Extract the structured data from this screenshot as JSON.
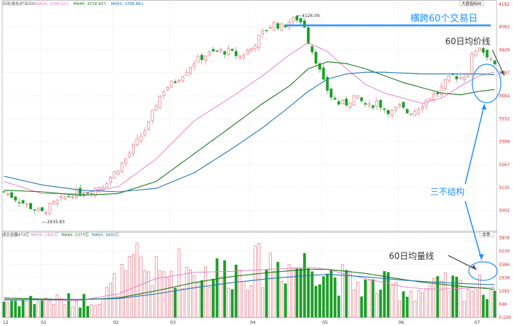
{
  "header": {
    "price_segments": [
      {
        "text": "日线(复权)",
        "color": "#555555"
      },
      {
        "text": "沪深300",
        "color": "#555555"
      },
      {
        "text": "MA20: 3794.22↑",
        "color": "#e377c2"
      },
      {
        "text": "MA40: 3716.93↑",
        "color": "#1a7a1a"
      },
      {
        "text": "MA60: 3786.88↓",
        "color": "#1f77b4"
      }
    ],
    "volume_segments": [
      {
        "text": "成交金额",
        "color": "#555555"
      },
      {
        "text": "1472亿",
        "color": "#555555"
      },
      {
        "text": "MA20: 1491亿",
        "color": "#e377c2"
      },
      {
        "text": "MA40: 1377亿",
        "color": "#1a7a1a"
      },
      {
        "text": "MA60: 1601亿",
        "color": "#1f77b4"
      }
    ],
    "top_right_button": "大盘指标纠",
    "volume_right_button": "全景"
  },
  "colors": {
    "up": "#e0606f",
    "down": "#1e9e2a",
    "ma20": "#e377c2",
    "ma40": "#1a7a1a",
    "ma60": "#1f77b4",
    "annotation": "#1e90ff",
    "grid": "#bfbfbf",
    "axis_text": "#d62728"
  },
  "chart_data": {
    "type": "candlestick",
    "price_axis": {
      "ylim": [
        2900,
        4200
      ],
      "ticks": [
        "4192",
        "4062",
        "3929",
        "3797",
        "3664",
        "3532",
        "3399",
        "3267",
        "3135",
        "3002"
      ],
      "tick_values": [
        4192,
        4062,
        3929,
        3797,
        3664,
        3532,
        3399,
        3267,
        3135,
        3002
      ]
    },
    "volume_axis": {
      "ylim": [
        0,
        3900
      ],
      "ticks": [
        "3876",
        "3230",
        "2584",
        "1938",
        "1292",
        "646",
        "0,100"
      ],
      "tick_values": [
        3876,
        3230,
        2584,
        1938,
        1292,
        646,
        0
      ]
    },
    "x_labels": [
      {
        "label": "12",
        "index": 0
      },
      {
        "label": "01",
        "index": 10
      },
      {
        "label": "02",
        "index": 29
      },
      {
        "label": "03",
        "index": 44
      },
      {
        "label": "04",
        "index": 65
      },
      {
        "label": "05",
        "index": 84
      },
      {
        "label": "06",
        "index": 104
      },
      {
        "label": "07",
        "index": 124
      }
    ],
    "num_bars": 130,
    "price_keypoints": [
      [
        0,
        3110
      ],
      [
        4,
        3060
      ],
      [
        8,
        3010
      ],
      [
        10,
        2990
      ],
      [
        13,
        3040
      ],
      [
        18,
        3100
      ],
      [
        22,
        3110
      ],
      [
        26,
        3150
      ],
      [
        29,
        3220
      ],
      [
        32,
        3300
      ],
      [
        35,
        3400
      ],
      [
        38,
        3500
      ],
      [
        40,
        3620
      ],
      [
        42,
        3700
      ],
      [
        45,
        3750
      ],
      [
        47,
        3790
      ],
      [
        50,
        3860
      ],
      [
        53,
        3900
      ],
      [
        56,
        3920
      ],
      [
        59,
        3920
      ],
      [
        62,
        3890
      ],
      [
        65,
        3940
      ],
      [
        67,
        4000
      ],
      [
        69,
        4050
      ],
      [
        71,
        4080
      ],
      [
        73,
        4060
      ],
      [
        75,
        4090
      ],
      [
        77,
        4110
      ],
      [
        79,
        4070
      ],
      [
        80,
        3980
      ],
      [
        82,
        3870
      ],
      [
        84,
        3740
      ],
      [
        86,
        3660
      ],
      [
        88,
        3620
      ],
      [
        90,
        3620
      ],
      [
        92,
        3660
      ],
      [
        94,
        3630
      ],
      [
        96,
        3600
      ],
      [
        98,
        3630
      ],
      [
        100,
        3590
      ],
      [
        102,
        3570
      ],
      [
        104,
        3600
      ],
      [
        106,
        3570
      ],
      [
        108,
        3580
      ],
      [
        110,
        3620
      ],
      [
        112,
        3660
      ],
      [
        114,
        3680
      ],
      [
        116,
        3740
      ],
      [
        118,
        3780
      ],
      [
        120,
        3770
      ],
      [
        122,
        3800
      ],
      [
        123,
        3890
      ],
      [
        124,
        3930
      ],
      [
        125,
        3950
      ],
      [
        126,
        3920
      ],
      [
        127,
        3900
      ],
      [
        128,
        3880
      ],
      [
        129,
        3830
      ]
    ],
    "volume_keypoints": [
      [
        0,
        800
      ],
      [
        10,
        850
      ],
      [
        20,
        820
      ],
      [
        26,
        1000
      ],
      [
        28,
        1400
      ],
      [
        30,
        1800
      ],
      [
        33,
        2100
      ],
      [
        35,
        2800
      ],
      [
        37,
        2400
      ],
      [
        39,
        2200
      ],
      [
        41,
        2000
      ],
      [
        43,
        2100
      ],
      [
        45,
        2500
      ],
      [
        50,
        2300
      ],
      [
        55,
        2200
      ],
      [
        60,
        2300
      ],
      [
        64,
        2400
      ],
      [
        67,
        2500
      ],
      [
        70,
        2700
      ],
      [
        73,
        2600
      ],
      [
        76,
        2500
      ],
      [
        79,
        2600
      ],
      [
        82,
        2700
      ],
      [
        85,
        2300
      ],
      [
        88,
        1900
      ],
      [
        91,
        1700
      ],
      [
        94,
        1600
      ],
      [
        97,
        1500
      ],
      [
        100,
        1600
      ],
      [
        103,
        1400
      ],
      [
        106,
        1300
      ],
      [
        109,
        1300
      ],
      [
        112,
        1400
      ],
      [
        115,
        1500
      ],
      [
        118,
        1600
      ],
      [
        121,
        1450
      ],
      [
        124,
        1500
      ],
      [
        127,
        1450
      ],
      [
        129,
        1400
      ]
    ],
    "ma_price": {
      "MA20": [
        [
          0,
          3170
        ],
        [
          10,
          3100
        ],
        [
          20,
          3100
        ],
        [
          30,
          3140
        ],
        [
          40,
          3300
        ],
        [
          50,
          3520
        ],
        [
          60,
          3660
        ],
        [
          68,
          3780
        ],
        [
          75,
          3900
        ],
        [
          80,
          3970
        ],
        [
          85,
          3920
        ],
        [
          90,
          3820
        ],
        [
          95,
          3730
        ],
        [
          100,
          3680
        ],
        [
          105,
          3650
        ],
        [
          110,
          3620
        ],
        [
          115,
          3650
        ],
        [
          120,
          3720
        ],
        [
          125,
          3780
        ],
        [
          129,
          3800
        ]
      ],
      "MA40": [
        [
          0,
          3120
        ],
        [
          10,
          3110
        ],
        [
          20,
          3090
        ],
        [
          30,
          3100
        ],
        [
          40,
          3170
        ],
        [
          50,
          3330
        ],
        [
          60,
          3490
        ],
        [
          68,
          3620
        ],
        [
          75,
          3720
        ],
        [
          80,
          3820
        ],
        [
          85,
          3860
        ],
        [
          90,
          3850
        ],
        [
          95,
          3820
        ],
        [
          100,
          3780
        ],
        [
          105,
          3740
        ],
        [
          110,
          3710
        ],
        [
          115,
          3680
        ],
        [
          120,
          3670
        ],
        [
          125,
          3690
        ],
        [
          129,
          3700
        ]
      ],
      "MA60": [
        [
          0,
          3200
        ],
        [
          10,
          3150
        ],
        [
          20,
          3120
        ],
        [
          30,
          3110
        ],
        [
          40,
          3130
        ],
        [
          50,
          3220
        ],
        [
          60,
          3360
        ],
        [
          68,
          3480
        ],
        [
          75,
          3600
        ],
        [
          80,
          3690
        ],
        [
          85,
          3760
        ],
        [
          90,
          3790
        ],
        [
          95,
          3800
        ],
        [
          100,
          3800
        ],
        [
          105,
          3795
        ],
        [
          110,
          3790
        ],
        [
          115,
          3790
        ],
        [
          120,
          3790
        ],
        [
          125,
          3790
        ],
        [
          129,
          3786
        ]
      ]
    },
    "ma_volume": {
      "MA20": [
        [
          0,
          900
        ],
        [
          10,
          850
        ],
        [
          20,
          830
        ],
        [
          30,
          1150
        ],
        [
          40,
          1900
        ],
        [
          50,
          2200
        ],
        [
          60,
          2250
        ],
        [
          70,
          2350
        ],
        [
          80,
          2450
        ],
        [
          85,
          2350
        ],
        [
          90,
          2100
        ],
        [
          95,
          1900
        ],
        [
          100,
          1700
        ],
        [
          105,
          1500
        ],
        [
          110,
          1400
        ],
        [
          115,
          1380
        ],
        [
          120,
          1420
        ],
        [
          125,
          1450
        ],
        [
          129,
          1480
        ]
      ],
      "MA40": [
        [
          0,
          950
        ],
        [
          10,
          900
        ],
        [
          20,
          870
        ],
        [
          30,
          950
        ],
        [
          40,
          1300
        ],
        [
          50,
          1700
        ],
        [
          60,
          2000
        ],
        [
          70,
          2200
        ],
        [
          80,
          2350
        ],
        [
          85,
          2350
        ],
        [
          90,
          2250
        ],
        [
          95,
          2150
        ],
        [
          100,
          2000
        ],
        [
          105,
          1850
        ],
        [
          110,
          1720
        ],
        [
          115,
          1620
        ],
        [
          120,
          1520
        ],
        [
          125,
          1440
        ],
        [
          129,
          1380
        ]
      ],
      "MA60": [
        [
          0,
          850
        ],
        [
          10,
          870
        ],
        [
          20,
          880
        ],
        [
          30,
          920
        ],
        [
          40,
          1150
        ],
        [
          50,
          1450
        ],
        [
          60,
          1700
        ],
        [
          70,
          1900
        ],
        [
          80,
          2050
        ],
        [
          85,
          2100
        ],
        [
          90,
          2050
        ],
        [
          95,
          1980
        ],
        [
          100,
          1900
        ],
        [
          105,
          1820
        ],
        [
          110,
          1760
        ],
        [
          115,
          1710
        ],
        [
          120,
          1660
        ],
        [
          125,
          1620
        ],
        [
          129,
          1600
        ]
      ]
    },
    "point_labels": [
      {
        "text": "4126.09",
        "index": 77,
        "value": 4126
      },
      {
        "text": "2935.83",
        "index": 10,
        "value": 2936
      }
    ]
  },
  "annotations": {
    "horizontal_label": "横跨60个交易日",
    "ma60_price_label": "60日均价线",
    "three_no_label": "三不结构",
    "ma60_volume_label": "60日均量线"
  }
}
